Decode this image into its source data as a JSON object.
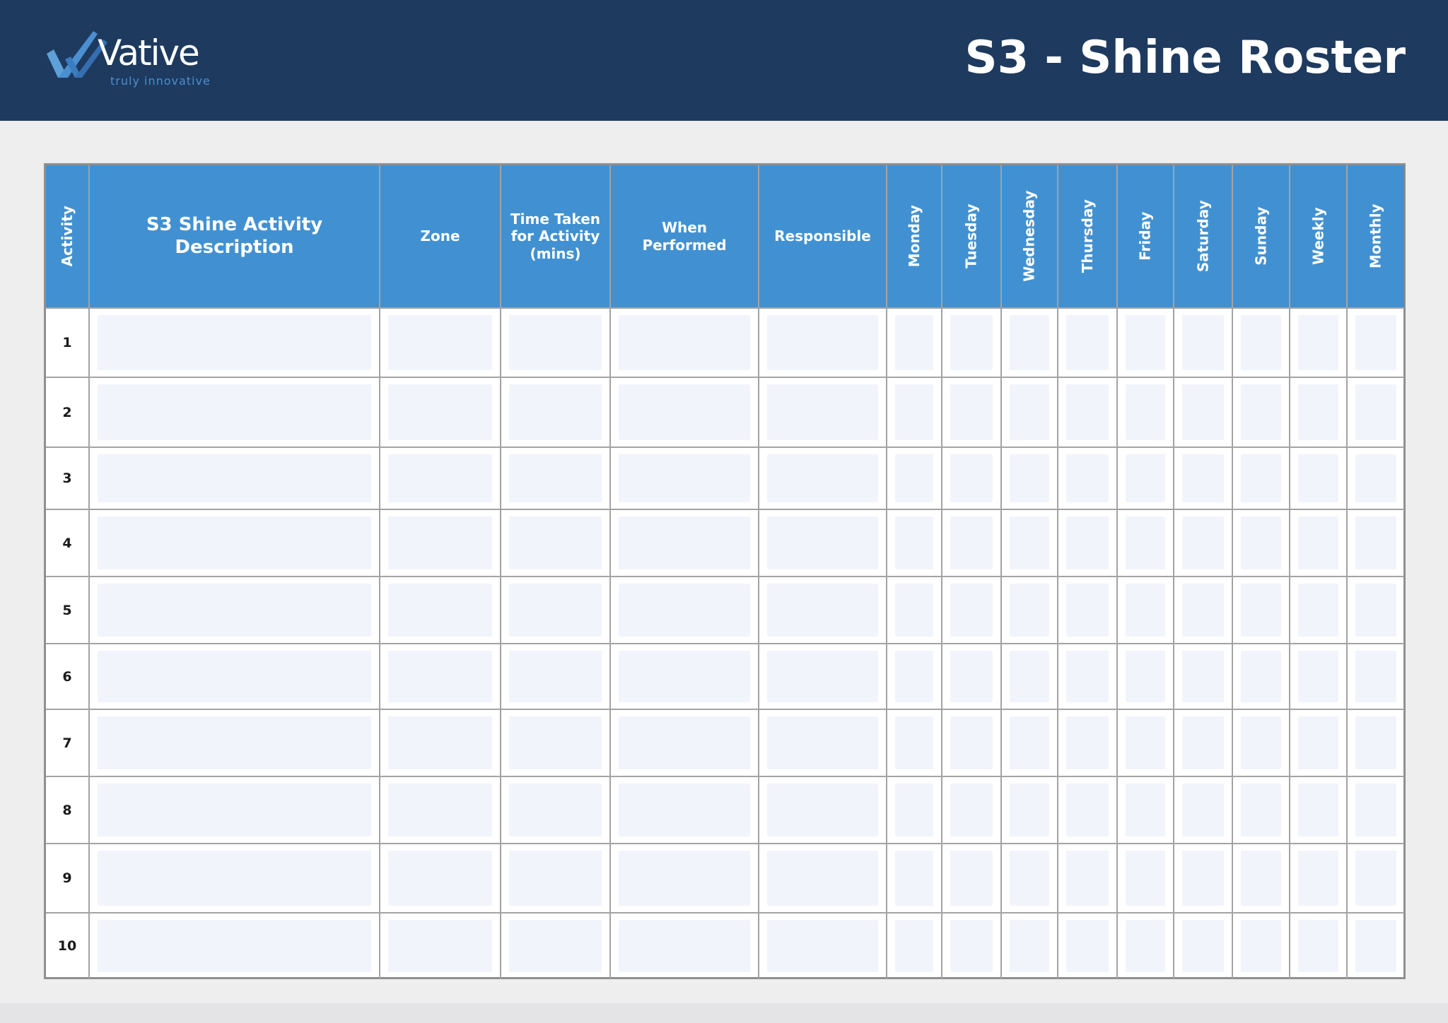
{
  "header": {
    "title": "S3 - Shine Roster",
    "logo_name": "Vative",
    "logo_tagline": "truly innovative",
    "bg_color": "#1e3a5f",
    "accent_color": "#4191d2"
  },
  "table": {
    "columns": [
      {
        "key": "activity",
        "label": "Activity",
        "vertical": true
      },
      {
        "key": "description",
        "label": "S3 Shine Activity\nDescription",
        "vertical": false
      },
      {
        "key": "zone",
        "label": "Zone",
        "vertical": false
      },
      {
        "key": "time",
        "label": "Time Taken\nfor Activity\n(mins)",
        "vertical": false
      },
      {
        "key": "when",
        "label": "When\nPerformed",
        "vertical": false
      },
      {
        "key": "responsible",
        "label": "Responsible",
        "vertical": false
      },
      {
        "key": "monday",
        "label": "Monday",
        "vertical": true
      },
      {
        "key": "tuesday",
        "label": "Tuesday",
        "vertical": true
      },
      {
        "key": "wednesday",
        "label": "Wednesday",
        "vertical": true
      },
      {
        "key": "thursday",
        "label": "Thursday",
        "vertical": true
      },
      {
        "key": "friday",
        "label": "Friday",
        "vertical": true
      },
      {
        "key": "saturday",
        "label": "Saturday",
        "vertical": true
      },
      {
        "key": "sunday",
        "label": "Sunday",
        "vertical": true
      },
      {
        "key": "weekly",
        "label": "Weekly",
        "vertical": true
      },
      {
        "key": "monthly",
        "label": "Monthly",
        "vertical": true
      }
    ],
    "rows": [
      "1",
      "2",
      "3",
      "4",
      "5",
      "6",
      "7",
      "8",
      "9",
      "10"
    ]
  }
}
